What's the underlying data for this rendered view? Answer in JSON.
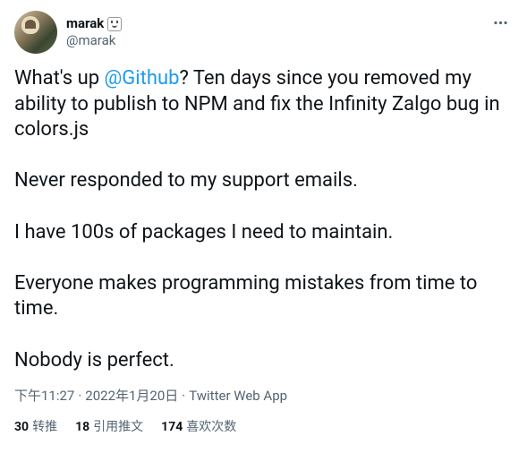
{
  "header": {
    "display_name": "marak",
    "handle": "@marak"
  },
  "body": {
    "pre_mention": "What's up ",
    "mention": "@Github",
    "post_mention": "? Ten days since you removed my ability to publish to NPM and fix the Infinity Zalgo bug in colors.js\n\nNever responded to my support emails.\n\nI have 100s of packages I need to maintain.\n\nEveryone makes programming mistakes from time to time.\n\nNobody is perfect."
  },
  "meta": {
    "time": "下午11:27",
    "date": "2022年1月20日",
    "source": "Twitter Web App"
  },
  "stats": {
    "retweets_num": "30",
    "retweets_label": "转推",
    "quotes_num": "18",
    "quotes_label": "引用推文",
    "likes_num": "174",
    "likes_label": "喜欢次数"
  }
}
